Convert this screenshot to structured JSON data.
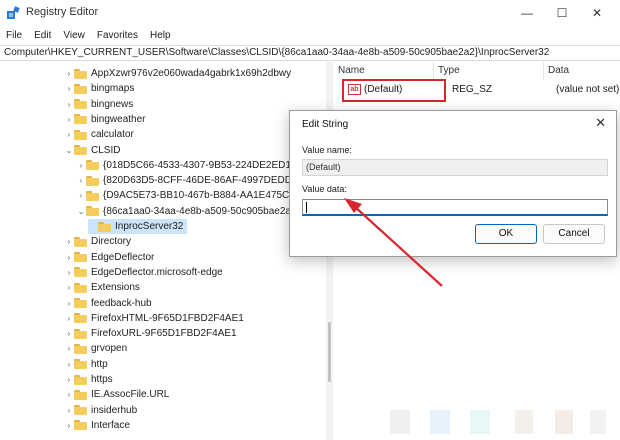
{
  "window": {
    "title": "Registry Editor",
    "minimize_glyph": "—",
    "maximize_glyph": "☐",
    "close_glyph": "✕"
  },
  "menu": [
    "File",
    "Edit",
    "View",
    "Favorites",
    "Help"
  ],
  "address": "Computer\\HKEY_CURRENT_USER\\Software\\Classes\\CLSID\\{86ca1aa0-34aa-4e8b-a509-50c905bae2a2}\\InprocServer32",
  "tree": [
    {
      "label": "AppXzwr976v2e060wada4gabrk1x69h2dbwy",
      "chevron": "›",
      "depth": 0
    },
    {
      "label": "bingmaps",
      "chevron": "›",
      "depth": 0
    },
    {
      "label": "bingnews",
      "chevron": "›",
      "depth": 0
    },
    {
      "label": "bingweather",
      "chevron": "›",
      "depth": 0
    },
    {
      "label": "calculator",
      "chevron": "›",
      "depth": 0
    },
    {
      "label": "CLSID",
      "chevron": "⌄",
      "depth": 0
    },
    {
      "label": "{018D5C66-4533-4307-9B53-224DE2ED1FE6}",
      "chevron": "›",
      "depth": 1
    },
    {
      "label": "{820D63D5-8CFF-46DE-86AF-4997DEDD6E6D}",
      "chevron": "›",
      "depth": 1
    },
    {
      "label": "{D9AC5E73-BB10-467b-B884-AA1E475C51F5}",
      "chevron": "›",
      "depth": 1
    },
    {
      "label": "{86ca1aa0-34aa-4e8b-a509-50c905bae2a2}",
      "chevron": "⌄",
      "depth": 1
    },
    {
      "label": "InprocServer32",
      "chevron": "",
      "depth": 2,
      "selected": true
    },
    {
      "label": "Directory",
      "chevron": "›",
      "depth": 0
    },
    {
      "label": "EdgeDeflector",
      "chevron": "›",
      "depth": 0
    },
    {
      "label": "EdgeDeflector.microsoft-edge",
      "chevron": "›",
      "depth": 0
    },
    {
      "label": "Extensions",
      "chevron": "›",
      "depth": 0
    },
    {
      "label": "feedback-hub",
      "chevron": "›",
      "depth": 0
    },
    {
      "label": "FirefoxHTML-9F65D1FBD2F4AE1",
      "chevron": "›",
      "depth": 0
    },
    {
      "label": "FirefoxURL-9F65D1FBD2F4AE1",
      "chevron": "›",
      "depth": 0
    },
    {
      "label": "grvopen",
      "chevron": "›",
      "depth": 0
    },
    {
      "label": "http",
      "chevron": "›",
      "depth": 0
    },
    {
      "label": "https",
      "chevron": "›",
      "depth": 0
    },
    {
      "label": "IE.AssocFile.URL",
      "chevron": "›",
      "depth": 0
    },
    {
      "label": "insiderhub",
      "chevron": "›",
      "depth": 0
    },
    {
      "label": "Interface",
      "chevron": "›",
      "depth": 0
    }
  ],
  "list": {
    "columns": [
      "Name",
      "Type",
      "Data"
    ],
    "rows": [
      {
        "icon": "ab",
        "name": "(Default)",
        "type": "REG_SZ",
        "data": "(value not set)"
      }
    ]
  },
  "dialog": {
    "title": "Edit String",
    "close_glyph": "✕",
    "value_name_label": "Value name:",
    "value_name": "(Default)",
    "value_data_label": "Value data:",
    "value_data": "",
    "ok_label": "OK",
    "cancel_label": "Cancel"
  },
  "colors": {
    "highlight": "#d8252e",
    "selection": "#cce4f7",
    "accent": "#0067c0"
  }
}
